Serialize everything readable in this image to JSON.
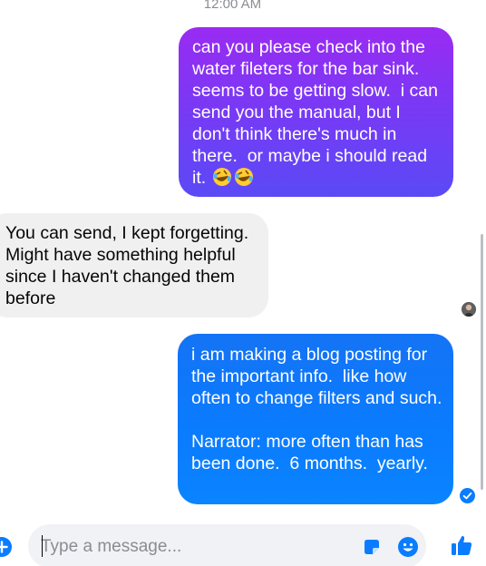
{
  "conversation": {
    "timestamp": "12:00 AM",
    "messages": [
      {
        "direction": "outgoing",
        "text": "can you please check into the water fileters for the bar sink.  seems to be getting slow.  i can send you the manual, but I don't think there's much in there.  or maybe i should read it.",
        "emoji": [
          "rolling-on-floor-laughing",
          "rolling-on-floor-laughing"
        ]
      },
      {
        "direction": "incoming",
        "text": "You can send, I kept forgetting. Might have something helpful since I haven't changed them before"
      },
      {
        "direction": "outgoing",
        "text": "i am making a blog posting for the important info.  like how often to change filters and such.\n\nNarrator: more often than has been done.  6 months.  yearly."
      }
    ],
    "seen_avatar_icon": "user-avatar",
    "read_receipt_icon": "check-circle-icon"
  },
  "composer": {
    "placeholder": "Type a message...",
    "value": "",
    "icons": {
      "more_actions": "plus-circle-icon",
      "sticker": "sticker-icon",
      "emoji": "smiley-icon",
      "send_like": "thumbs-up-icon"
    }
  },
  "colors": {
    "accent": "#0a7cff",
    "outgoing_gradient_top": "#9a2bf2",
    "outgoing_gradient_bottom": "#5b4af6",
    "incoming_bubble": "#f0f0f0"
  }
}
